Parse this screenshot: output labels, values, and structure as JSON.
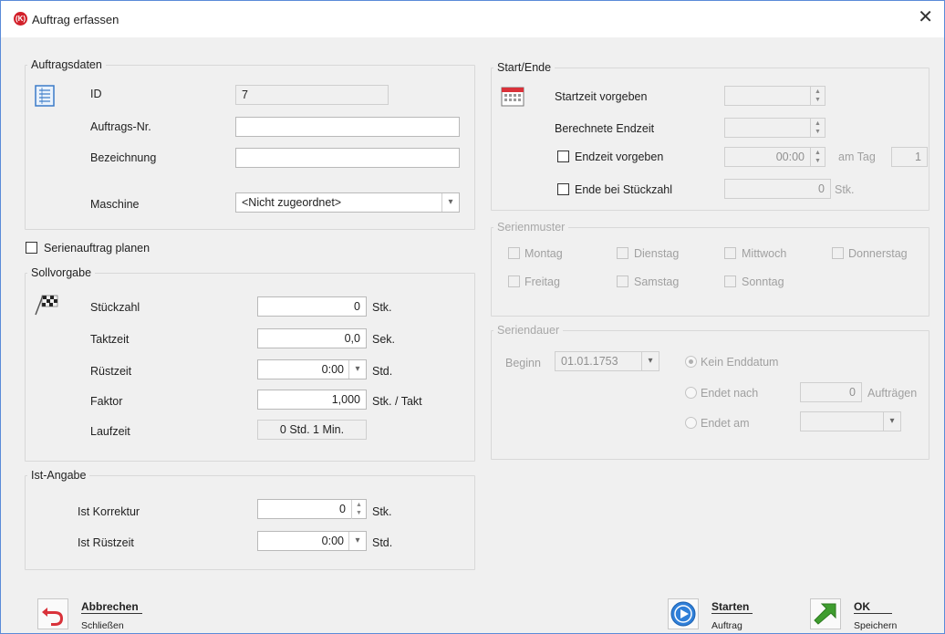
{
  "window": {
    "title": "Auftrag erfassen"
  },
  "auftragsdaten": {
    "legend": "Auftragsdaten",
    "id_label": "ID",
    "id_value": "7",
    "nr_label": "Auftrags-Nr.",
    "nr_value": "",
    "bez_label": "Bezeichnung",
    "bez_value": "",
    "maschine_label": "Maschine",
    "maschine_value": "<Nicht zugeordnet>"
  },
  "serie_check_label": "Serienauftrag planen",
  "sollvorgabe": {
    "legend": "Sollvorgabe",
    "stueck_label": "Stückzahl",
    "stueck_value": "0",
    "stueck_unit": "Stk.",
    "takt_label": "Taktzeit",
    "takt_value": "0,0",
    "takt_unit": "Sek.",
    "ruest_label": "Rüstzeit",
    "ruest_value": "0:00",
    "ruest_unit": "Std.",
    "faktor_label": "Faktor",
    "faktor_value": "1,000",
    "faktor_unit": "Stk. / Takt",
    "lauf_label": "Laufzeit",
    "lauf_value": "0 Std. 1 Min."
  },
  "ist": {
    "legend": "Ist-Angabe",
    "korr_label": "Ist Korrektur",
    "korr_value": "0",
    "korr_unit": "Stk.",
    "ruest_label": "Ist Rüstzeit",
    "ruest_value": "0:00",
    "ruest_unit": "Std."
  },
  "startende": {
    "legend": "Start/Ende",
    "startzeit_label": "Startzeit vorgeben",
    "startzeit_value": "",
    "endzeit_label": "Berechnete Endzeit",
    "endzeit_value": "",
    "endzeit_vorgeben_label": "Endzeit vorgeben",
    "endzeit_vorgeben_value": "00:00",
    "am_tag_label": "am Tag",
    "am_tag_value": "1",
    "ende_stueck_label": "Ende bei Stückzahl",
    "ende_stueck_value": "0",
    "ende_stueck_unit": "Stk."
  },
  "serienmuster": {
    "legend": "Serienmuster",
    "days": [
      "Montag",
      "Dienstag",
      "Mittwoch",
      "Donnerstag",
      "Freitag",
      "Samstag",
      "Sonntag"
    ]
  },
  "seriendauer": {
    "legend": "Seriendauer",
    "beginn_label": "Beginn",
    "beginn_value": "01.01.1753",
    "kein_enddatum_label": "Kein Enddatum",
    "endet_nach_label": "Endet nach",
    "endet_nach_value": "0",
    "endet_nach_unit": "Aufträgen",
    "endet_am_label": "Endet am",
    "endet_am_value": ""
  },
  "buttons": {
    "abbrechen_title": "Abbrechen",
    "abbrechen_sub": "Schließen",
    "starten_title": "Starten",
    "starten_sub": "Auftrag",
    "ok_title": "OK",
    "ok_sub": "Speichern"
  },
  "colors": {
    "accent": "#2f7fd8",
    "cancel_red": "#d9323a",
    "ok_green": "#3f9d2f",
    "window_border": "#5a8bd8"
  }
}
